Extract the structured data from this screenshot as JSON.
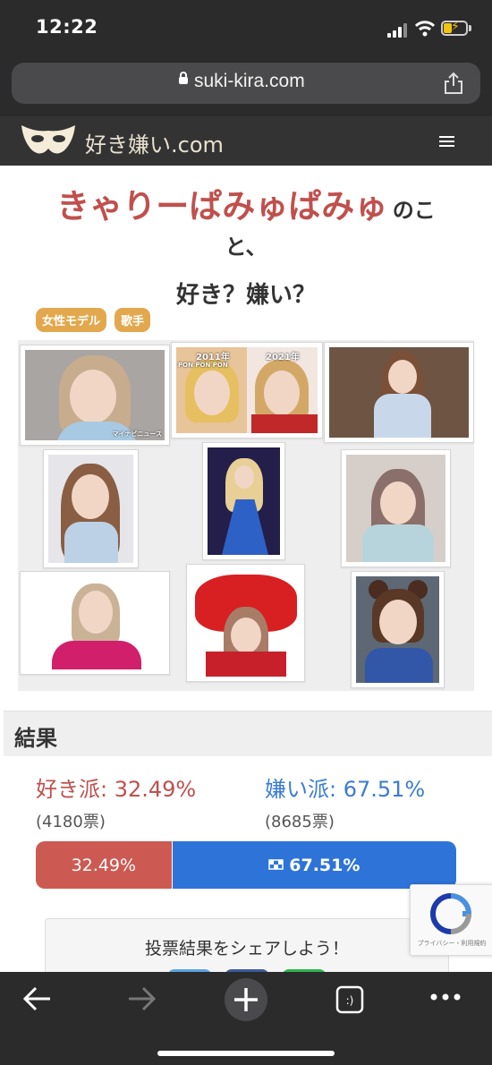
{
  "status_bar": {
    "time": "12:22"
  },
  "browser": {
    "url": "suki-kira.com"
  },
  "site": {
    "logo_text": "好き嫌い.com"
  },
  "page": {
    "title_name": "きゃりーぱみゅぱみゅ",
    "title_tail": "のこ",
    "title_line2": "と、",
    "title_line3": "好き？嫌い？",
    "tags": [
      "女性モデル",
      "歌手"
    ]
  },
  "gallery": {
    "photo1_caption": "マイナビニュース",
    "photo2_left_label": "2011年",
    "photo2_right_label": "2021年",
    "photo2_sub": "PON PON PON"
  },
  "results": {
    "heading": "結果",
    "like_label": "好き派: 32.49%",
    "dislike_label": "嫌い派: 67.51%",
    "like_votes": "(4180票)",
    "dislike_votes": "(8685票)",
    "like_pct": 32.49,
    "like_bar_text": "32.49%",
    "dislike_bar_text": "67.51%",
    "share_text": "投票結果をシェアしよう！"
  },
  "recaptcha": {
    "text": "プライバシー・利用規約"
  },
  "colors": {
    "like": "#cd5a52",
    "dislike": "#2e74d8",
    "tag": "#e3a84d",
    "title_name": "#c0504d"
  }
}
